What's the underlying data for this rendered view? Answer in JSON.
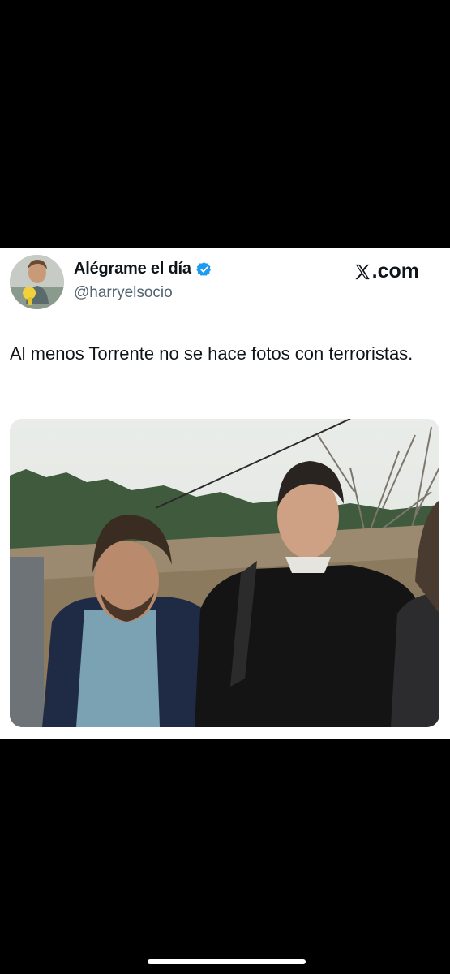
{
  "tweet": {
    "display_name": "Alégrame el día",
    "handle": "@harryelsocio",
    "verified": true,
    "brand": ".com",
    "brand_icon": "x-logo-icon",
    "text": "Al menos Torrente no se hace fotos con terroristas."
  },
  "colors": {
    "background": "#000000",
    "card": "#ffffff",
    "text": "#0f1419",
    "secondary_text": "#536471",
    "verified": "#1d9bf0"
  }
}
